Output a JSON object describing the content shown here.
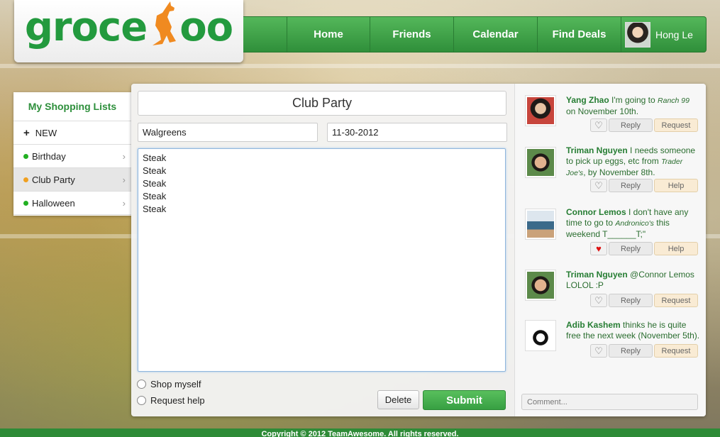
{
  "logo": {
    "text_before": "groce",
    "text_after": "oo"
  },
  "nav": {
    "items": [
      "Home",
      "Friends",
      "Calendar",
      "Find Deals"
    ],
    "user_name": "Hong Le"
  },
  "sidebar": {
    "title": "My Shopping Lists",
    "new_label": "NEW",
    "lists": [
      {
        "label": "Birthday",
        "dot_color": "#22b022"
      },
      {
        "label": "Club Party",
        "dot_color": "#f0a020"
      },
      {
        "label": "Halloween",
        "dot_color": "#22b022"
      }
    ]
  },
  "list": {
    "title": "Club Party",
    "store": "Walgreens",
    "date": "11-30-2012",
    "items": [
      "Steak",
      "Steak",
      "Steak",
      "Steak",
      "Steak"
    ],
    "options": [
      "Shop myself",
      "Request help"
    ],
    "delete_label": "Delete",
    "submit_label": "Submit"
  },
  "feed": {
    "posts": [
      {
        "name": "Yang Zhao",
        "pre": " I'm going to ",
        "em": "Ranch 99",
        "post": " on November 10th.",
        "liked": false,
        "reply": "Reply",
        "action": "Request"
      },
      {
        "name": "Triman Nguyen",
        "pre": " I needs someone to pick up eggs, etc from ",
        "em": "Trader Joe's",
        "post": ", by November 8th.",
        "liked": false,
        "reply": "Reply",
        "action": "Help"
      },
      {
        "name": "Connor Lemos",
        "pre": " I don't have any time to go to ",
        "em": "Andronico's",
        "post": " this weekend T______T;\"",
        "liked": true,
        "reply": "Reply",
        "action": "Help"
      },
      {
        "name": "Triman Nguyen",
        "pre": " @Connor Lemos LOLOL :P",
        "em": "",
        "post": "",
        "liked": false,
        "reply": "Reply",
        "action": "Request"
      },
      {
        "name": "Adib Kashem",
        "pre": " thinks he is quite free the next week (November 5th).",
        "em": "",
        "post": "",
        "liked": false,
        "reply": "Reply",
        "action": "Request"
      }
    ],
    "comment_placeholder": "Comment..."
  },
  "footer": {
    "text": "Copyright © 2012 TeamAwesome. All rights reserved."
  },
  "colors": {
    "brand_green": "#2d8f3b",
    "kangaroo_orange": "#f08a20",
    "request_bg": "#f9ebd4"
  }
}
